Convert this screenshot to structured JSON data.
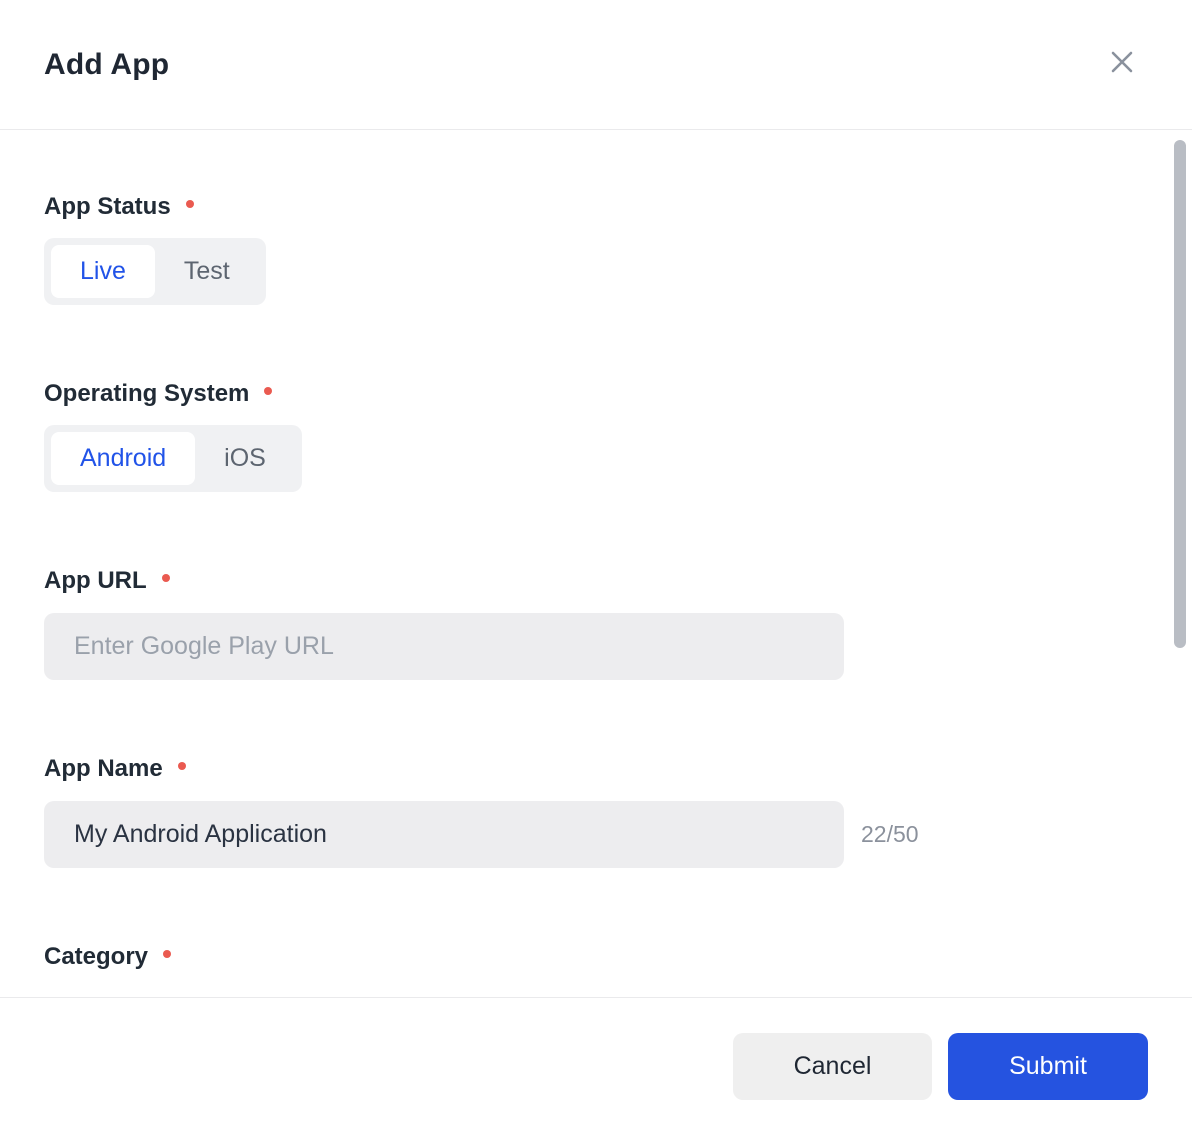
{
  "header": {
    "title": "Add App"
  },
  "form": {
    "app_status": {
      "label": "App Status",
      "required": true,
      "options": [
        "Live",
        "Test"
      ],
      "selected": "Live"
    },
    "operating_system": {
      "label": "Operating System",
      "required": true,
      "options": [
        "Android",
        "iOS"
      ],
      "selected": "Android"
    },
    "app_url": {
      "label": "App URL",
      "required": true,
      "placeholder": "Enter Google Play URL",
      "value": ""
    },
    "app_name": {
      "label": "App Name",
      "required": true,
      "value": "My Android Application",
      "counter": "22/50"
    },
    "category": {
      "label": "Category",
      "required": true
    }
  },
  "footer": {
    "cancel_label": "Cancel",
    "submit_label": "Submit"
  },
  "colors": {
    "accent_blue": "#2553e0",
    "selected_text_blue": "#2153e8",
    "required_dot_red": "#ea5a50",
    "input_bg": "#ededef",
    "segment_bg": "#f0f1f3",
    "divider": "#eaeaec",
    "scrollbar_thumb": "#b9bdc4"
  }
}
